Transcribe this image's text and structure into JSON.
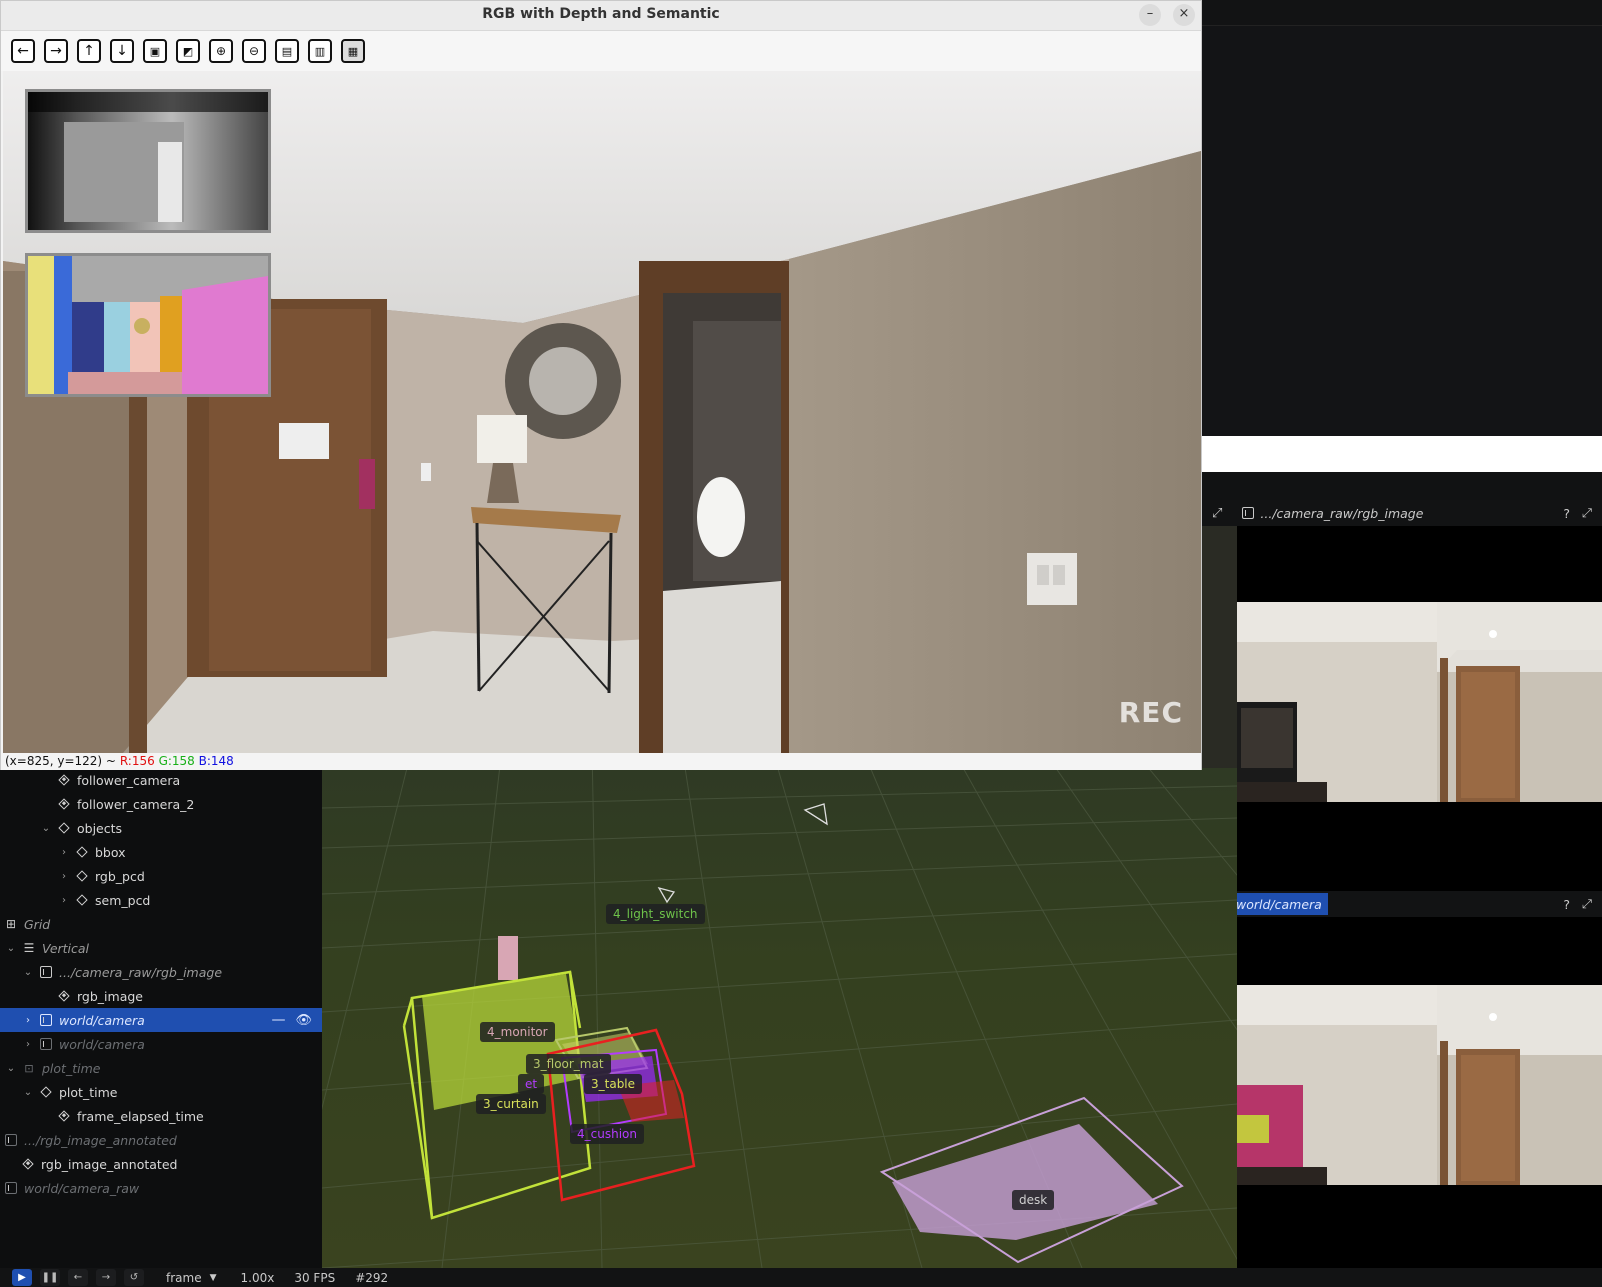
{
  "window": {
    "title": "RGB with Depth and Semantic",
    "minimize_icon": "–",
    "close_icon": "×",
    "toolbar_icons": [
      "arrow-left-icon",
      "arrow-right-icon",
      "arrow-up-icon",
      "arrow-down-icon",
      "fit-image-icon",
      "image-settings-icon",
      "zoom-in-icon",
      "zoom-out-icon",
      "save-icon",
      "copy-icon",
      "properties-icon"
    ],
    "overlay_text": "REC",
    "status": {
      "coords": "(x=825, y=122) ~",
      "r": "R:156",
      "g": "G:158",
      "b": "B:148",
      "r_color": "#e01010",
      "g_color": "#18b018",
      "b_color": "#1010e0"
    }
  },
  "tree": {
    "items": [
      {
        "label": "follower_camera"
      },
      {
        "label": "follower_camera_2"
      },
      {
        "label": "objects"
      },
      {
        "label": "bbox"
      },
      {
        "label": "rgb_pcd"
      },
      {
        "label": "sem_pcd"
      },
      {
        "label": "Grid"
      },
      {
        "label": "Vertical"
      },
      {
        "label": ".../camera_raw/rgb_image"
      },
      {
        "label": "rgb_image"
      },
      {
        "label": "world/camera"
      },
      {
        "label": "world/camera"
      },
      {
        "label": "plot_time"
      },
      {
        "label": "plot_time"
      },
      {
        "label": "frame_elapsed_time"
      },
      {
        "label": ".../rgb_image_annotated"
      },
      {
        "label": "rgb_image_annotated"
      },
      {
        "label": "world/camera_raw"
      }
    ],
    "selected_color": "#1f4fb0"
  },
  "view3d": {
    "labels": {
      "light_switch": "4_light_switch",
      "monitor": "4_monitor",
      "floor_mat": "3_floor_mat",
      "table": "3_table",
      "curtain": "3_curtain",
      "cushion": "4_cushion",
      "desk": "desk",
      "occluded": "et"
    },
    "colors": {
      "light_switch": "#6ec24a",
      "monitor": "#d8a6b4",
      "floor_mat": "#b7c86a",
      "table": "#d9e25a",
      "curtain": "#d9e25a",
      "cushion": "#b33cff",
      "desk": "#d0d0d0"
    }
  },
  "panels": {
    "top": {
      "title": ".../camera_raw/rgb_image",
      "help": "?"
    },
    "bottom": {
      "title": "world/camera",
      "help": "?"
    }
  },
  "bottombar": {
    "timeline": "frame",
    "speed": "1.00x",
    "fps": "30 FPS",
    "frame": "#292"
  }
}
